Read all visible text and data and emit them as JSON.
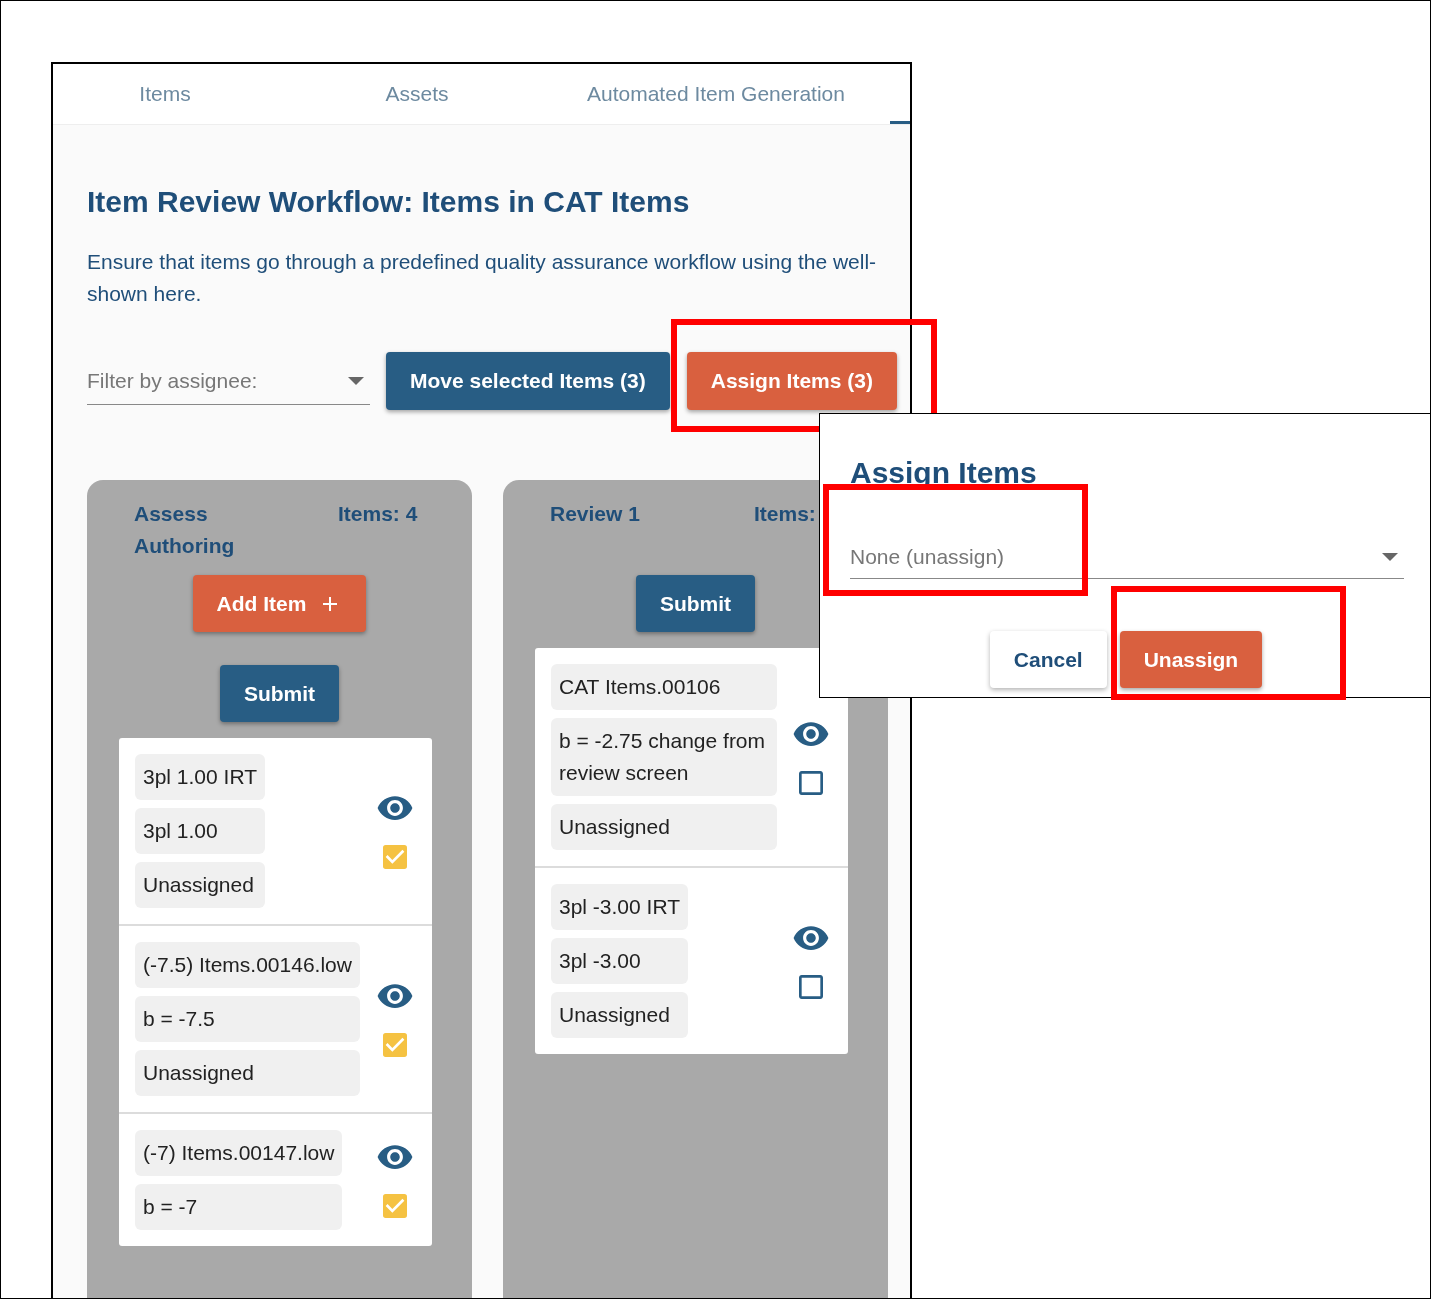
{
  "tabs": [
    {
      "label": "Items",
      "selected": false
    },
    {
      "label": "Assets",
      "selected": false
    },
    {
      "label": "Automated Item Generation",
      "selected": false
    }
  ],
  "page": {
    "title": "Item Review Workflow: Items in CAT Items",
    "description_lines": [
      "Ensure that items go through a predefined quality assurance workflow using the well-",
      "shown here."
    ]
  },
  "toolbar": {
    "filter": {
      "placeholder": "Filter by assignee:"
    },
    "buttons": [
      {
        "label": "Move selected Items (3)",
        "kind": "primary"
      },
      {
        "label": "Assign Items (3)",
        "kind": "accent"
      }
    ]
  },
  "columns": [
    {
      "title": "Assess Authoring",
      "count": "Items: 4",
      "buttons": [
        {
          "label": "Add Item",
          "kind": "add"
        },
        {
          "label": "Submit",
          "kind": "primary"
        }
      ],
      "items": [
        {
          "fields": [
            "3pl 1.00 IRT",
            "3pl 1.00",
            "Unassigned"
          ],
          "checked": true
        },
        {
          "fields": [
            "(-7.5) Items.00146.low",
            "b = -7.5",
            "Unassigned"
          ],
          "checked": true
        },
        {
          "fields": [
            "(-7) Items.00147.low",
            "b = -7"
          ],
          "checked": true
        }
      ]
    },
    {
      "title": "Review 1",
      "count": "Items:",
      "buttons": [
        {
          "label": "Submit",
          "kind": "primary"
        }
      ],
      "items": [
        {
          "fields": [
            "CAT Items.00106",
            "b = -2.75 change from review screen",
            "Unassigned"
          ],
          "checked": false
        },
        {
          "fields": [
            "3pl -3.00 IRT",
            "3pl -3.00",
            "Unassigned"
          ],
          "checked": false
        }
      ]
    }
  ],
  "dialog": {
    "title": "Assign Items",
    "select": {
      "value": "None (unassign)"
    },
    "buttons": [
      {
        "label": "Cancel",
        "kind": "secondary"
      },
      {
        "label": "Unassign",
        "kind": "accent"
      }
    ]
  }
}
